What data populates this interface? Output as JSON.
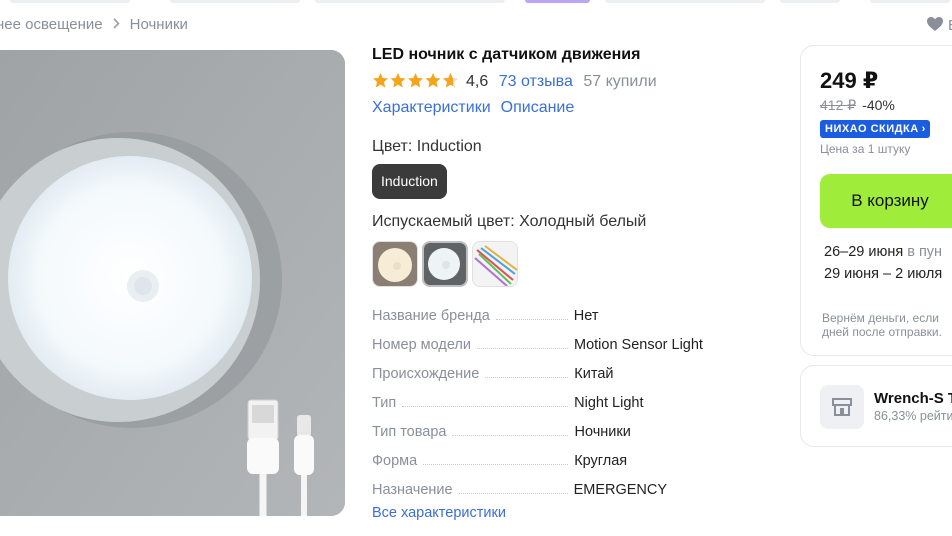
{
  "breadcrumb": {
    "items": [
      "нее освещение",
      "Ночники"
    ]
  },
  "favorite": {
    "label": "В",
    "icon": "heart-icon"
  },
  "product": {
    "title": "LED ночник с датчиком движения",
    "rating": "4,6",
    "stars": 4.6,
    "reviews": "73 отзыва",
    "purchases": "57 купили",
    "tabs": [
      "Характеристики",
      "Описание"
    ],
    "color_label": "Цвет: Induction",
    "color_option": "Induction",
    "light_label": "Испускаемый цвет: Холодный белый",
    "specs": [
      {
        "key": "Название бренда",
        "value": "Нет"
      },
      {
        "key": "Номер модели",
        "value": "Motion Sensor Light"
      },
      {
        "key": "Происхождение",
        "value": "Китай"
      },
      {
        "key": "Тип",
        "value": "Night Light"
      },
      {
        "key": "Тип товара",
        "value": "Ночники"
      },
      {
        "key": "Форма",
        "value": "Круглая"
      },
      {
        "key": "Назначение",
        "value": "EMERGENCY"
      }
    ],
    "all_specs_link": "Все характеристики"
  },
  "purchase": {
    "price": "249 ₽",
    "old_price": "412 ₽",
    "discount": "-40%",
    "badge": "НИХАО СКИДКА",
    "unit_note": "Цена за 1 штуку",
    "cart_button": "В корзину",
    "delivery": [
      {
        "dates": "26–29 июня",
        "where": " в пун"
      },
      {
        "dates": "29 июня – 2 июля",
        "where": ""
      }
    ],
    "refund_lines": [
      "Вернём деньги, если",
      "дней после отправки."
    ]
  },
  "seller": {
    "name": "Wrench-S T",
    "rating": "86,33% рейти"
  },
  "colors": {
    "link": "#3a6fd8",
    "cart_button": "#9fed3a",
    "badge": "#1b5de0",
    "chip": "#3b3b3b"
  }
}
